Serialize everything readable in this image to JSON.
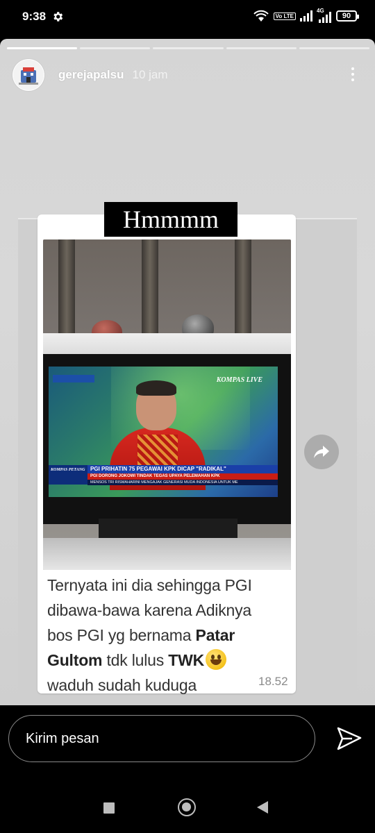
{
  "status_bar": {
    "time": "9:38",
    "volte_label": "Vo LTE",
    "network_label": "4G",
    "battery": "90"
  },
  "story": {
    "progress_segments": 5,
    "username": "gerejapalsu",
    "time_ago": "10 jam",
    "caption": "Hmmmm",
    "message": {
      "line1": "Ternyata ini dia sehingga PGI",
      "line2": "dibawa-bawa karena Adiknya",
      "line3_prefix": "bos PGI yg bernama ",
      "name_first": "Patar",
      "name_last": "Gultom",
      "line4_middle": " tdk lulus ",
      "twk": "TWK",
      "line5": "waduh sudah kuduga",
      "time": "18.52"
    },
    "tv": {
      "channel_logo": "KOMPAS LIVE",
      "ticker_logo": "KOMPAS PETANG",
      "headline": "PGI PRIHATIN 75 PEGAWAI KPK DICAP \"RADIKAL\"",
      "subheadline": "PGI DORONG JOKOWI TINDAK TEGAS UPAYA PELEMAHAN KPK",
      "crawl": "MENSOS TRI RISMAHARINI MENGAJAK GENERASI MUDA INDONESIA UNTUK ME"
    }
  },
  "reply": {
    "placeholder": "Kirim pesan"
  },
  "icons": {
    "settings": "gear-icon",
    "more": "more-vertical-icon",
    "share": "share-arrow-icon",
    "send": "send-icon",
    "emoji": "grinning-face-emoji"
  }
}
